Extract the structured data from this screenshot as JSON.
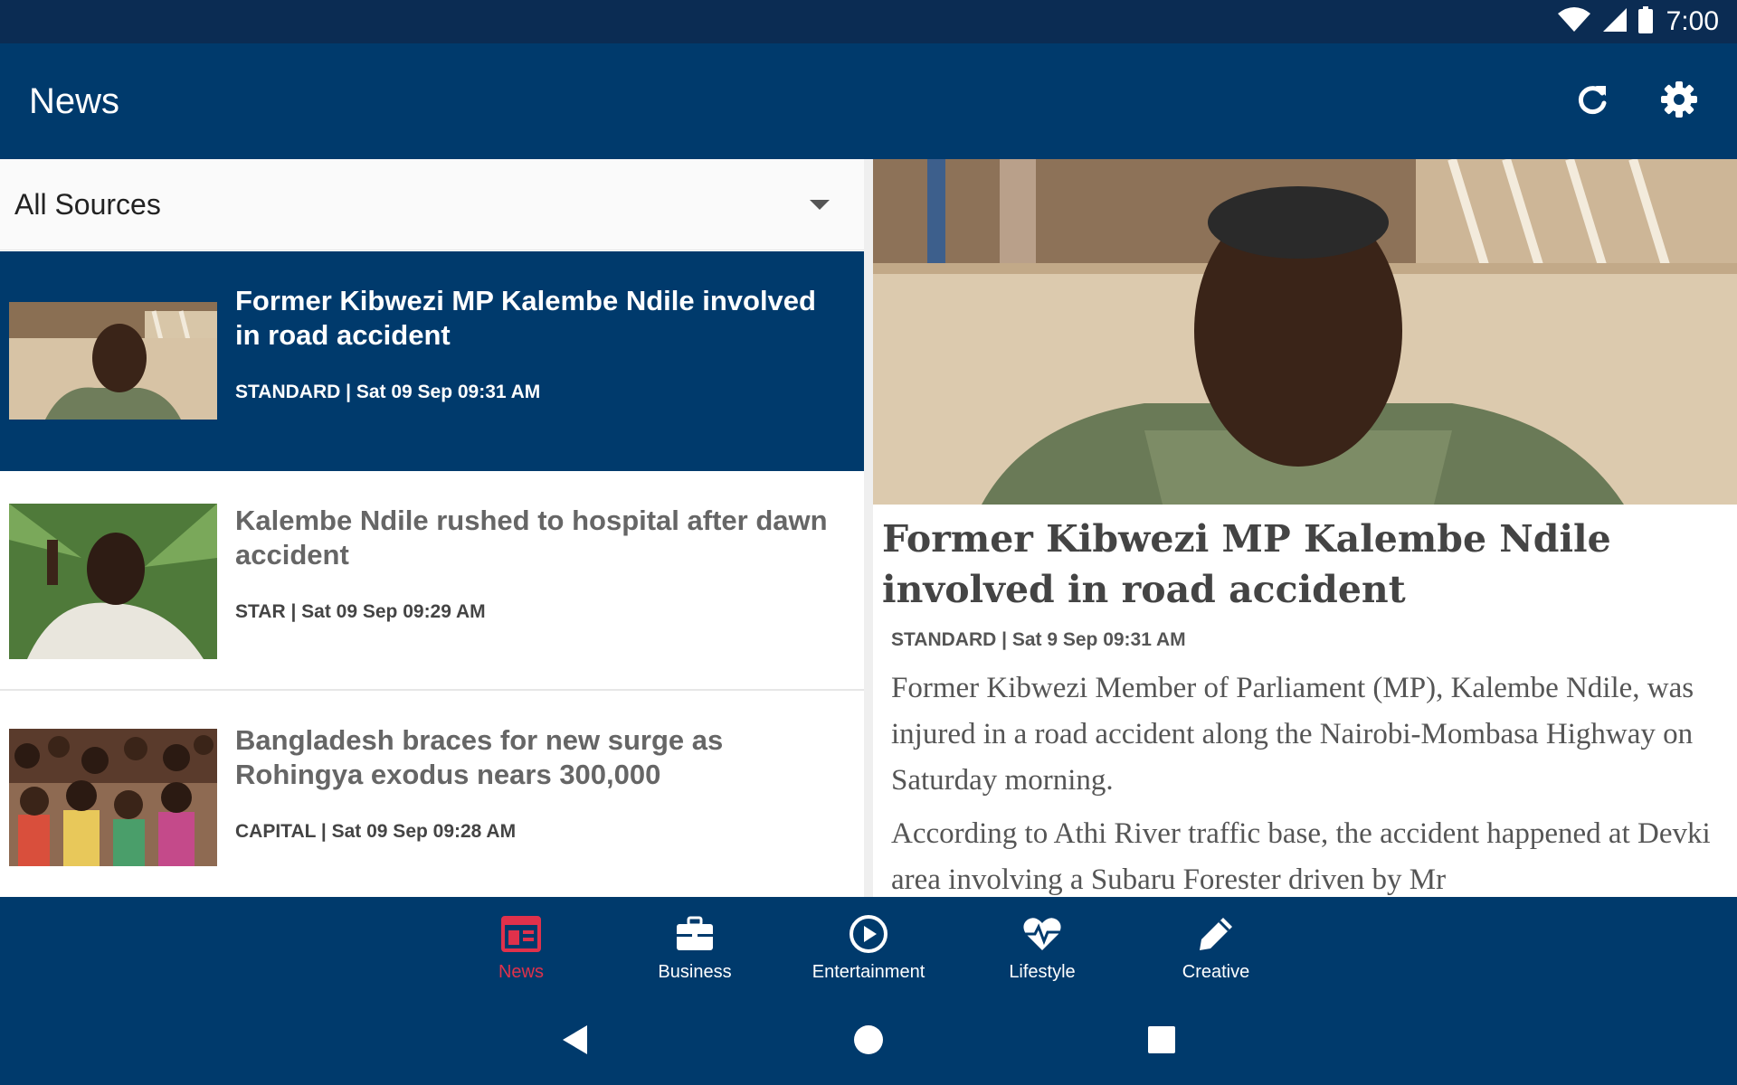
{
  "status_bar": {
    "time": "7:00",
    "icons": [
      "wifi-icon",
      "signal-icon",
      "battery-icon"
    ]
  },
  "app_bar": {
    "title": "News",
    "actions": [
      "refresh-icon",
      "settings-icon"
    ]
  },
  "source_filter": {
    "selected": "All Sources"
  },
  "news_list": [
    {
      "title": "Former Kibwezi MP Kalembe Ndile involved in road accident",
      "meta": "STANDARD | Sat 09 Sep 09:31 AM",
      "selected": true
    },
    {
      "title": "Kalembe Ndile rushed to hospital after dawn accident",
      "meta": "STAR | Sat 09 Sep 09:29 AM",
      "selected": false
    },
    {
      "title": "Bangladesh braces for new surge as Rohingya exodus nears 300,000",
      "meta": "CAPITAL | Sat 09 Sep 09:28 AM",
      "selected": false
    }
  ],
  "article": {
    "title": "Former Kibwezi MP Kalembe Ndile involved in road accident",
    "meta": "STANDARD | Sat 9 Sep 09:31 AM",
    "paragraphs": [
      "Former Kibwezi Member of Parliament (MP), Kalembe Ndile, was injured in a road accident along the Nairobi-Mombasa Highway on Saturday morning.",
      "According to Athi River traffic base, the accident happened at Devki area involving a Subaru Forester driven by Mr"
    ]
  },
  "bottom_nav": {
    "items": [
      {
        "label": "News",
        "icon": "newspaper-icon",
        "active": true
      },
      {
        "label": "Business",
        "icon": "briefcase-icon",
        "active": false
      },
      {
        "label": "Entertainment",
        "icon": "play-circle-icon",
        "active": false
      },
      {
        "label": "Lifestyle",
        "icon": "heartbeat-icon",
        "active": false
      },
      {
        "label": "Creative",
        "icon": "pencil-icon",
        "active": false
      }
    ]
  },
  "colors": {
    "status_bar": "#0b2c53",
    "primary": "#003a6c",
    "accent": "#e0314b",
    "selected_item": "#003a6c"
  }
}
